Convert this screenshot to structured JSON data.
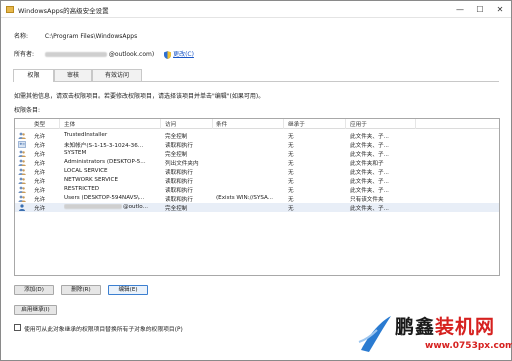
{
  "window": {
    "title": "WindowsApps的高级安全设置",
    "minimize_glyph": "—",
    "maximize_glyph": "☐",
    "close_glyph": "✕"
  },
  "info": {
    "name_label": "名称:",
    "name_value": "C:\\Program Files\\WindowsApps",
    "owner_label": "所有者:",
    "owner_value_suffix": "@outlook.com)",
    "change_link": "更改(C)"
  },
  "tabs": [
    {
      "label": "权限"
    },
    {
      "label": "审核"
    },
    {
      "label": "有效访问"
    }
  ],
  "hint_text": "如需其他信息，请双击权限项目。若要修改权限项目，请选择该项目并单击\"编辑\"(如果可用)。",
  "entries_label": "权限条目:",
  "table": {
    "headers": [
      "类型",
      "主体",
      "访问",
      "条件",
      "继承于",
      "应用于"
    ],
    "rows": [
      {
        "type": "允许",
        "principal": "TrustedInstaller",
        "access": "完全控制",
        "condition": "",
        "inherited": "无",
        "applies": "此文件夹、子...",
        "icon": "users-icon"
      },
      {
        "type": "允许",
        "principal": "未知帐户(S-1-15-3-1024-36...",
        "access": "读取和执行",
        "condition": "",
        "inherited": "无",
        "applies": "此文件夹、子...",
        "icon": "unknown-account-icon"
      },
      {
        "type": "允许",
        "principal": "SYSTEM",
        "access": "完全控制",
        "condition": "",
        "inherited": "无",
        "applies": "此文件夹、子...",
        "icon": "users-icon"
      },
      {
        "type": "允许",
        "principal": "Administrators (DESKTOP-5...",
        "access": "列出文件夹内",
        "condition": "",
        "inherited": "无",
        "applies": "此文件夹和子",
        "icon": "users-icon"
      },
      {
        "type": "允许",
        "principal": "LOCAL SERVICE",
        "access": "读取和执行",
        "condition": "",
        "inherited": "无",
        "applies": "此文件夹、子...",
        "icon": "users-icon"
      },
      {
        "type": "允许",
        "principal": "NETWORK SERVICE",
        "access": "读取和执行",
        "condition": "",
        "inherited": "无",
        "applies": "此文件夹、子...",
        "icon": "users-icon"
      },
      {
        "type": "允许",
        "principal": "RESTRICTED",
        "access": "读取和执行",
        "condition": "",
        "inherited": "无",
        "applies": "此文件夹、子...",
        "icon": "users-icon"
      },
      {
        "type": "允许",
        "principal": "Users (DESKTOP-594NAVS\\...",
        "access": "读取和执行",
        "condition": "(Exists WIN://SYSA...",
        "inherited": "无",
        "applies": "只有该文件夹",
        "icon": "users-icon"
      },
      {
        "type": "允许",
        "principal": "@outlo...",
        "access": "完全控制",
        "condition": "",
        "inherited": "无",
        "applies": "此文件夹、子...",
        "icon": "user-icon"
      }
    ]
  },
  "buttons": {
    "add": "添加(D)",
    "remove": "删除(R)",
    "edit": "编辑(E)",
    "enable_inheritance": "启用继承(I)"
  },
  "replace_checkbox_label": "使用可从此对象继承的权限项目替换所有子对象的权限项目(P)",
  "watermark": {
    "text_black": "鹏鑫",
    "text_red": "装机网",
    "url": "www.0753px.com"
  },
  "colors": {
    "link": "#1a56c6",
    "selected_row": "#e8eef7",
    "brand_red": "#d6211f"
  }
}
